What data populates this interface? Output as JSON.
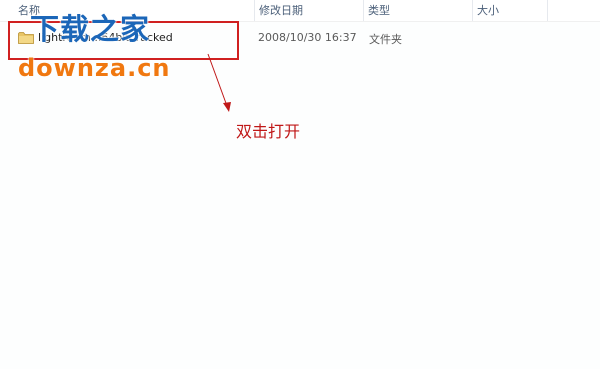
{
  "columns": {
    "name": "名称",
    "date": "修改日期",
    "type": "类型",
    "size": "大小"
  },
  "file": {
    "name": "lightroom...64bitcracked",
    "date": "2008/10/30 16:37",
    "type": "文件夹",
    "icon": "folder-icon"
  },
  "watermark": {
    "chinese": "下载之家",
    "url": "downza.cn"
  },
  "annotation": {
    "text": "双击打开"
  },
  "colors": {
    "highlight": "#d02020",
    "watermark_blue": "#1b66b8",
    "watermark_orange": "#f07810",
    "annotation": "#c01818"
  }
}
